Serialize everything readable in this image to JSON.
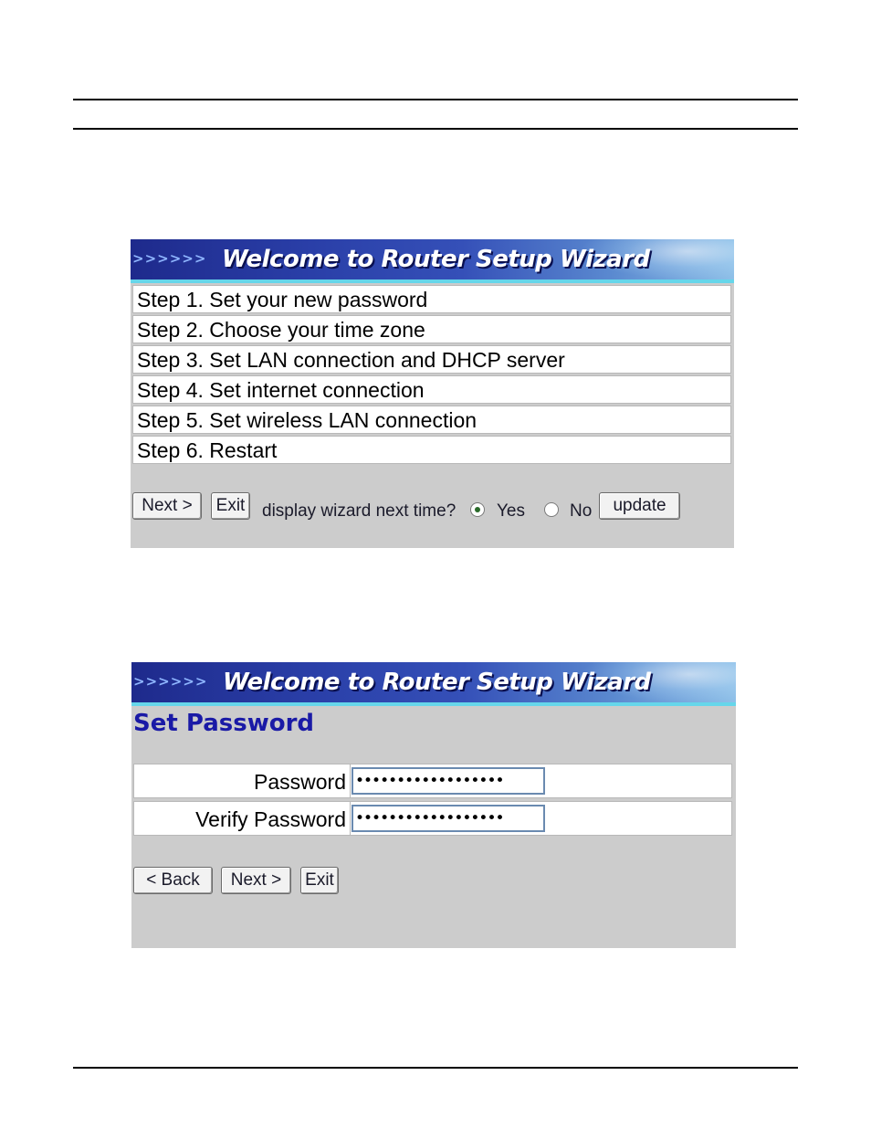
{
  "wizard_banner_title": "Welcome to Router Setup Wizard",
  "banner_arrows": ">>>>>>",
  "panel1": {
    "steps": [
      "Step 1. Set your new password",
      "Step 2. Choose your time zone",
      "Step 3. Set LAN connection and DHCP server",
      "Step 4. Set internet connection",
      "Step 5. Set wireless LAN connection",
      "Step 6. Restart"
    ],
    "next_label": "Next >",
    "exit_label": "Exit",
    "display_question": "display wizard next time?",
    "yes_label": "Yes",
    "no_label": "No",
    "selected": "Yes",
    "update_label": "update"
  },
  "panel2": {
    "heading": "Set Password",
    "password_label": "Password",
    "password_value": "••••••••••••••••••",
    "verify_label": "Verify Password",
    "verify_value": "••••••••••••••••••",
    "back_label": "< Back",
    "next_label": "Next >",
    "exit_label": "Exit"
  },
  "colors": {
    "banner_dark": "#1e2a8c",
    "banner_accent": "#66d6ea",
    "panel_bg": "#cccccc",
    "heading_blue": "#1a1aa6"
  }
}
